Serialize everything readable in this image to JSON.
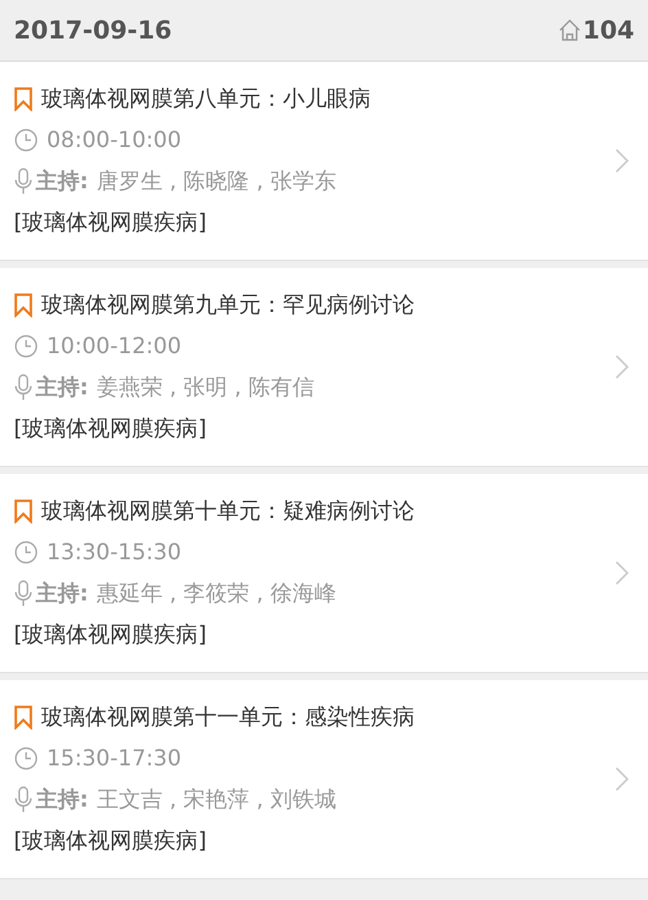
{
  "header": {
    "date": "2017-09-16",
    "room": "104"
  },
  "sessions": [
    {
      "title": "玻璃体视网膜第八单元：小儿眼病",
      "time": "08:00-10:00",
      "host_label": "主持:",
      "hosts": "唐罗生 , 陈晓隆 , 张学东",
      "tag": "[玻璃体视网膜疾病]"
    },
    {
      "title": "玻璃体视网膜第九单元：罕见病例讨论",
      "time": "10:00-12:00",
      "host_label": "主持:",
      "hosts": "姜燕荣 , 张明 , 陈有信",
      "tag": "[玻璃体视网膜疾病]"
    },
    {
      "title": "玻璃体视网膜第十单元：疑难病例讨论",
      "time": "13:30-15:30",
      "host_label": "主持:",
      "hosts": "惠延年 , 李筱荣 , 徐海峰",
      "tag": "[玻璃体视网膜疾病]"
    },
    {
      "title": "玻璃体视网膜第十一单元：感染性疾病",
      "time": "15:30-17:30",
      "host_label": "主持:",
      "hosts": "王文吉 , 宋艳萍 , 刘铁城",
      "tag": "[玻璃体视网膜疾病]"
    }
  ]
}
